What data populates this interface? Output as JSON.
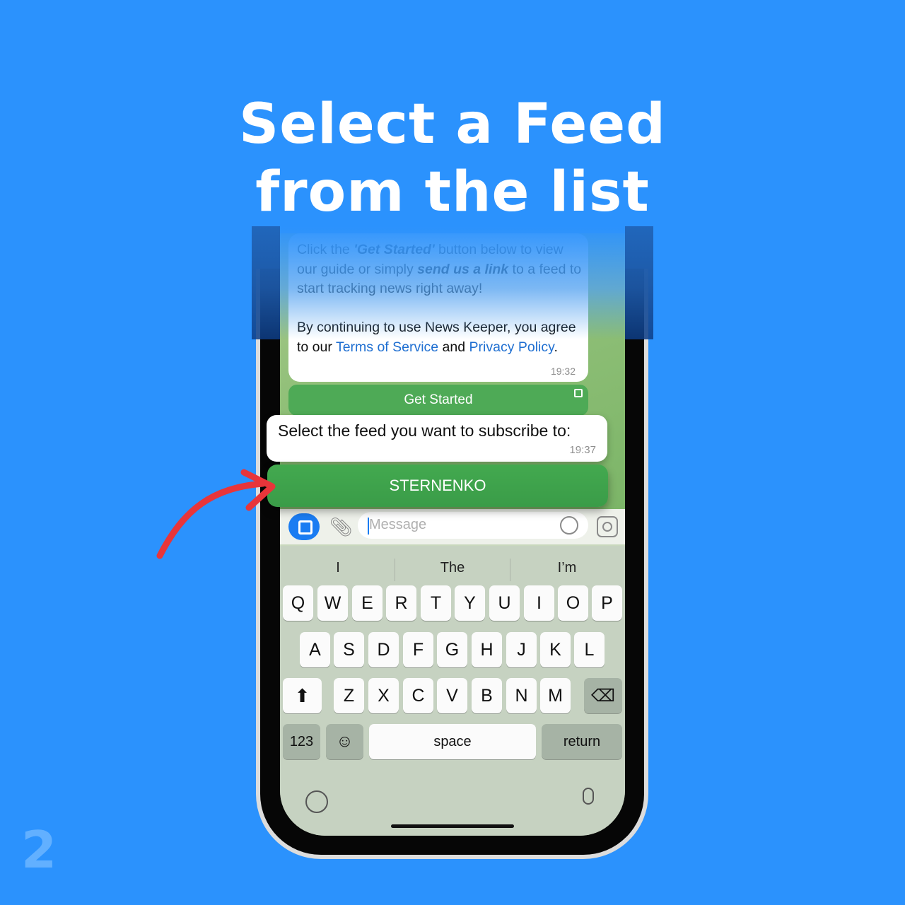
{
  "headline": [
    "Select a Feed",
    "from the list"
  ],
  "step_number": "2",
  "chat": {
    "intro_paragraph_1": [
      "Click the ",
      "'Get Started'",
      " button below to view our guide or simply ",
      "send us a link",
      " to a feed to start tracking news right away!"
    ],
    "intro_paragraph_2": {
      "prefix": "By continuing to use News Keeper, you agree to our ",
      "terms_link": "Terms of Service",
      "middle": " and ",
      "privacy_link": "Privacy Policy",
      "suffix": "."
    },
    "intro_time": "19:32",
    "get_started_label": "Get Started",
    "prompt_text": "Select the feed you want to subscribe to:",
    "prompt_time": "19:37",
    "feed_button_label": "STERNENKO"
  },
  "composer": {
    "placeholder": "Message"
  },
  "keyboard": {
    "suggestions": [
      "I",
      "The",
      "I’m"
    ],
    "row1": [
      "Q",
      "W",
      "E",
      "R",
      "T",
      "Y",
      "U",
      "I",
      "O",
      "P"
    ],
    "row2": [
      "A",
      "S",
      "D",
      "F",
      "G",
      "H",
      "J",
      "K",
      "L"
    ],
    "row3": [
      "Z",
      "X",
      "C",
      "V",
      "B",
      "N",
      "M"
    ],
    "numbers_label": "123",
    "space_label": "space",
    "return_label": "return"
  },
  "colors": {
    "background": "#2b92fd",
    "accent_green": "#3a9c48",
    "link_blue": "#1f6fd1",
    "arrow_red": "#e8353a"
  }
}
